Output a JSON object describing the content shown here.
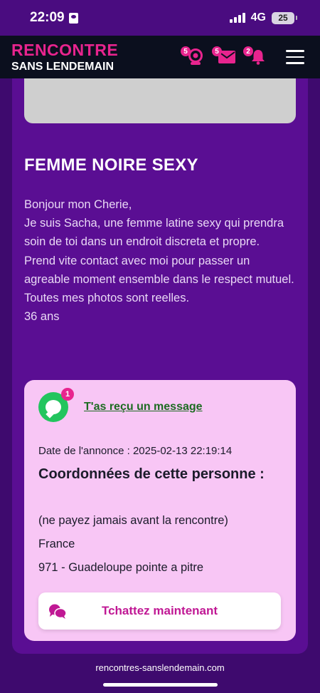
{
  "status_bar": {
    "time": "22:09",
    "network": "4G",
    "battery": "25"
  },
  "header": {
    "logo_top": "RENCONTRE",
    "logo_bottom": "SANS LENDEMAIN",
    "webcam_badge": "5",
    "mail_badge": "5",
    "notif_badge": "2"
  },
  "ad": {
    "title": "FEMME NOIRE SEXY",
    "description": [
      "Bonjour mon Cherie,",
      "Je suis Sacha, une femme latine sexy qui prendra soin de toi dans un endroit discreta et propre.",
      "Prend vite contact avec moi pour passer un agreable moment ensemble dans le respect mutuel.",
      "Toutes mes photos sont reelles.",
      "36 ans"
    ]
  },
  "info": {
    "message_badge": "1",
    "message_link": "T'as reçu un message",
    "date": "Date de l'annonce : 2025-02-13 22:19:14",
    "coords_title": "Coordonnées de cette personne :",
    "warning": "(ne payez jamais avant la rencontre)",
    "country": "France",
    "location": "971 - Guadeloupe pointe a pitre",
    "chat_button": "Tchattez maintenant"
  },
  "footer": {
    "url": "rencontres-sanslendemain.com"
  },
  "colors": {
    "brand_pink": "#e8248e",
    "card_purple": "#5a0e93",
    "info_bg": "#f8c6f5",
    "link_green": "#1d6b22"
  }
}
